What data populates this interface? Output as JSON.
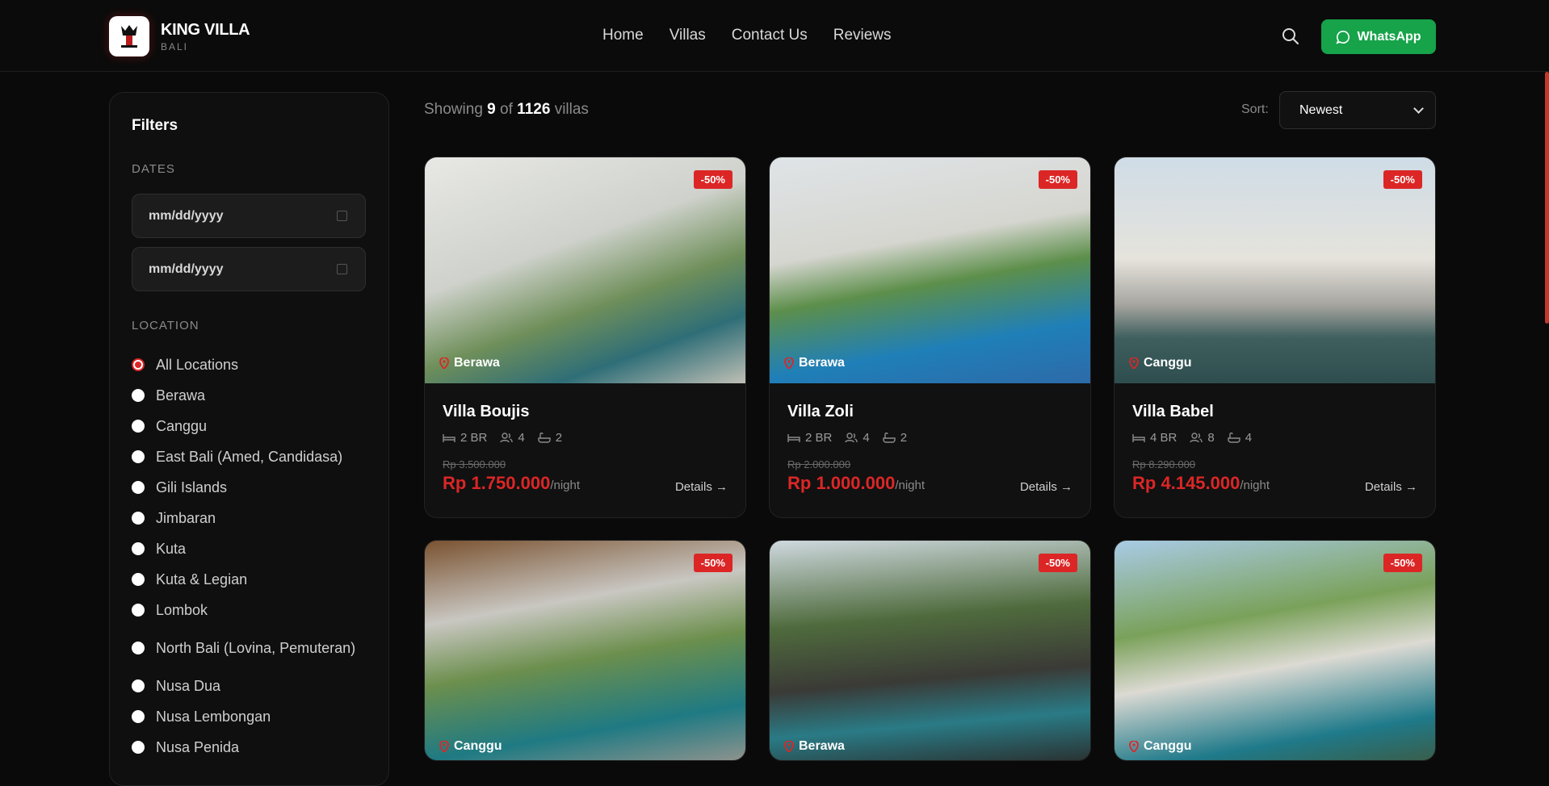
{
  "brand": {
    "name": "KING VILLA",
    "sub": "BALI"
  },
  "nav": [
    "Home",
    "Villas",
    "Contact Us",
    "Reviews"
  ],
  "whatsapp": "WhatsApp",
  "filters": {
    "title": "Filters",
    "dates_label": "DATES",
    "date_placeholder_1": "mm/dd/yyyy",
    "date_placeholder_2": "mm/dd/yyyy",
    "location_label": "LOCATION",
    "locations": [
      {
        "label": "All Locations",
        "selected": true
      },
      {
        "label": "Berawa",
        "selected": false
      },
      {
        "label": "Canggu",
        "selected": false
      },
      {
        "label": "East Bali (Amed, Candidasa)",
        "selected": false
      },
      {
        "label": "Gili Islands",
        "selected": false
      },
      {
        "label": "Jimbaran",
        "selected": false
      },
      {
        "label": "Kuta",
        "selected": false
      },
      {
        "label": "Kuta & Legian",
        "selected": false
      },
      {
        "label": "Lombok",
        "selected": false
      },
      {
        "label": "North Bali (Lovina, Pemuteran)",
        "selected": false
      },
      {
        "label": "Nusa Dua",
        "selected": false
      },
      {
        "label": "Nusa Lembongan",
        "selected": false
      },
      {
        "label": "Nusa Penida",
        "selected": false
      }
    ]
  },
  "results": {
    "prefix": "Showing",
    "shown": "9",
    "of": "of",
    "total": "1126",
    "suffix": "villas"
  },
  "sort": {
    "label": "Sort:",
    "value": "Newest"
  },
  "cards": [
    {
      "title": "Villa Boujis",
      "location": "Berawa",
      "badge": "-50%",
      "br": "2 BR",
      "guests": "4",
      "baths": "2",
      "old_price": "Rp 3.500.000",
      "price": "Rp 1.750.000",
      "per": "/night",
      "details": "Details"
    },
    {
      "title": "Villa Zoli",
      "location": "Berawa",
      "badge": "-50%",
      "br": "2 BR",
      "guests": "4",
      "baths": "2",
      "old_price": "Rp 2.000.000",
      "price": "Rp 1.000.000",
      "per": "/night",
      "details": "Details"
    },
    {
      "title": "Villa Babel",
      "location": "Canggu",
      "badge": "-50%",
      "br": "4 BR",
      "guests": "8",
      "baths": "4",
      "old_price": "Rp 8.290.000",
      "price": "Rp 4.145.000",
      "per": "/night",
      "details": "Details"
    },
    {
      "title": "",
      "location": "Canggu",
      "badge": "-50%"
    },
    {
      "title": "",
      "location": "Berawa",
      "badge": "-50%"
    },
    {
      "title": "",
      "location": "Canggu",
      "badge": "-50%"
    }
  ],
  "colors": {
    "accent": "#dc2626",
    "whatsapp": "#16a34a",
    "background": "#0a0a0a"
  }
}
